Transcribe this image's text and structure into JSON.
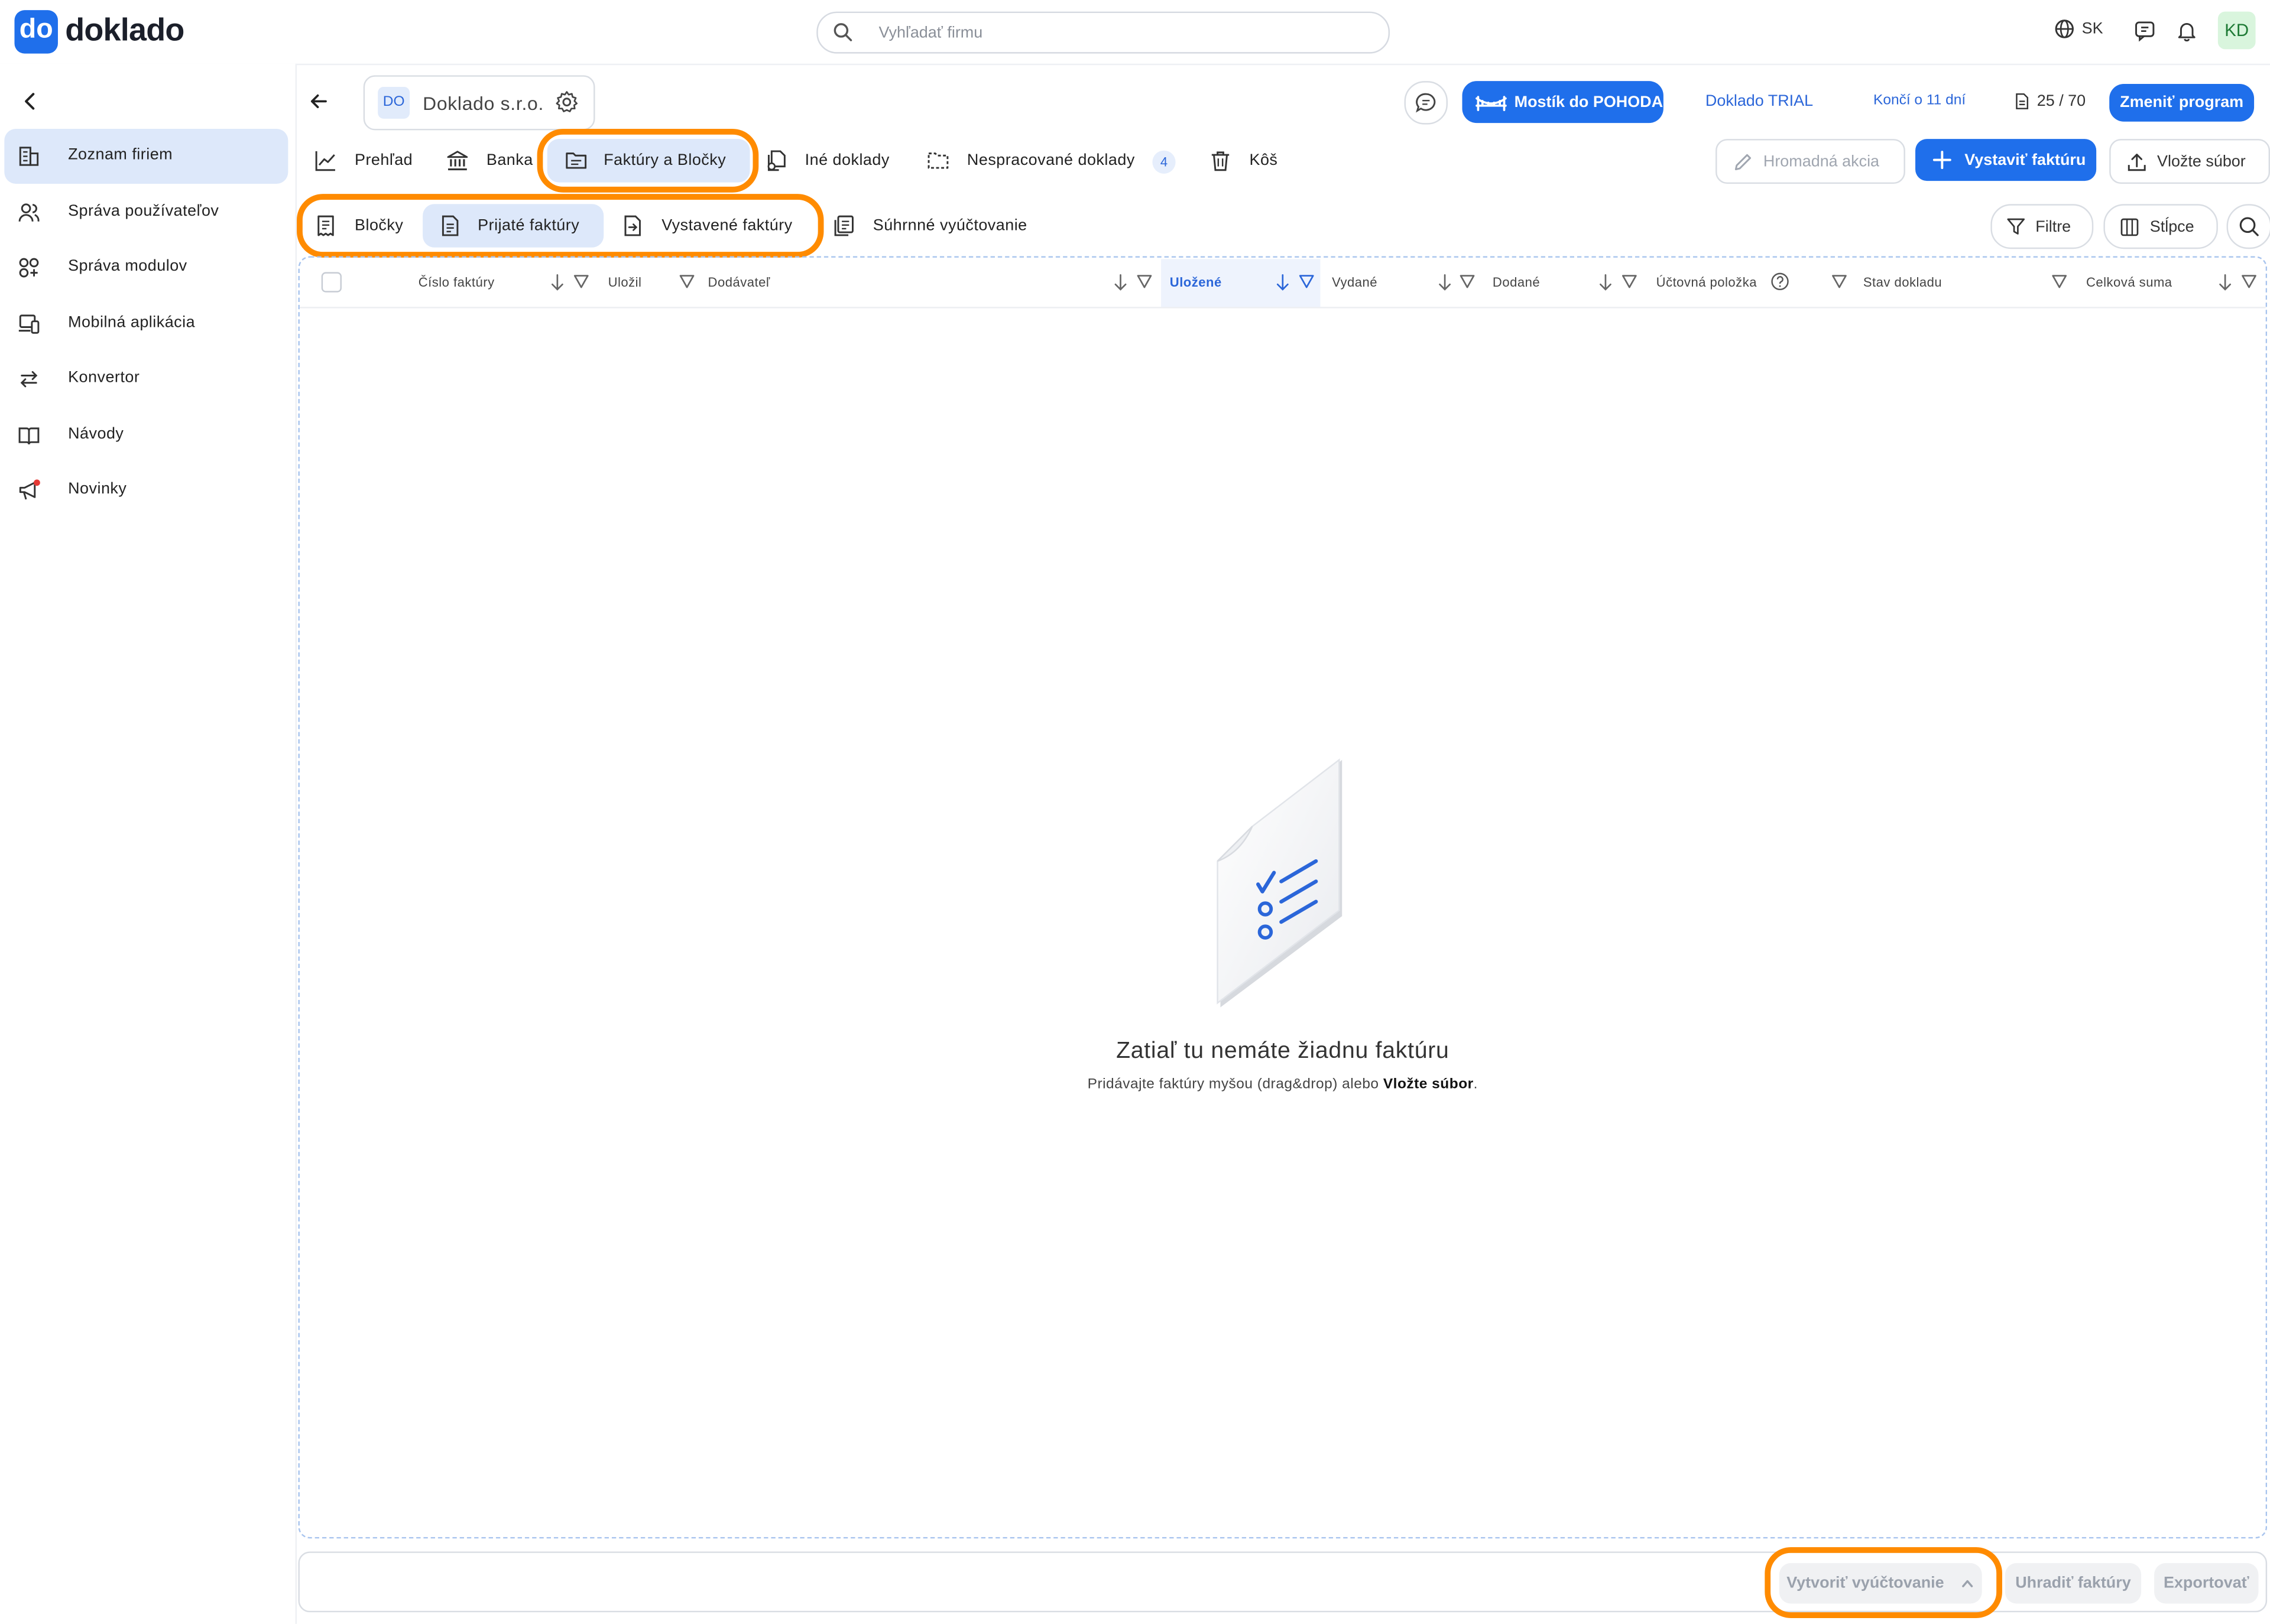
{
  "app": {
    "logo_mark": "do",
    "logo_text": "doklado",
    "accent": "#1f6feb",
    "highlight": "#ff8b00"
  },
  "header": {
    "search_placeholder": "Vyhľadať firmu",
    "language": "SK",
    "avatar_initials": "KD",
    "icons": [
      "globe-icon",
      "chat-icon",
      "bell-icon"
    ]
  },
  "sidebar": {
    "items": [
      {
        "label": "Zoznam firiem",
        "icon": "building-icon",
        "active": true
      },
      {
        "label": "Správa používateľov",
        "icon": "users-icon"
      },
      {
        "label": "Správa modulov",
        "icon": "modules-icon"
      },
      {
        "label": "Mobilná aplikácia",
        "icon": "devices-icon"
      },
      {
        "label": "Konvertor",
        "icon": "convert-icon"
      },
      {
        "label": "Návody",
        "icon": "book-icon"
      },
      {
        "label": "Novinky",
        "icon": "megaphone-icon"
      }
    ]
  },
  "company": {
    "initials": "DO",
    "name": "Doklado s.r.o."
  },
  "topbar": {
    "pohoda_label": "Mostík do POHODA",
    "trial_label": "Doklado TRIAL",
    "ends_label": "Končí o 11 dní",
    "counter": "25 / 70",
    "change_plan_label": "Zmeniť program"
  },
  "tabs": [
    {
      "label": "Prehľad",
      "icon": "chart-icon"
    },
    {
      "label": "Banka",
      "icon": "bank-icon"
    },
    {
      "label": "Faktúry a Bločky",
      "icon": "folder-icon",
      "active": true
    },
    {
      "label": "Iné doklady",
      "icon": "documents-icon"
    },
    {
      "label": "Nespracované doklady",
      "icon": "dashed-folder-icon",
      "badge": "4"
    },
    {
      "label": "Kôš",
      "icon": "trash-icon"
    }
  ],
  "actions": {
    "bulk_label": "Hromadná akcia",
    "issue_invoice_label": "Vystaviť faktúru",
    "upload_label": "Vložte súbor"
  },
  "subtabs": [
    {
      "label": "Bločky",
      "icon": "receipt-icon"
    },
    {
      "label": "Prijaté faktúry",
      "icon": "invoice-icon",
      "active": true
    },
    {
      "label": "Vystavené faktúry",
      "icon": "invoice-out-icon"
    },
    {
      "label": "Súhrnné vyúčtovanie",
      "icon": "summary-icon"
    }
  ],
  "toolbar": {
    "filters_label": "Filtre",
    "columns_label": "Stĺpce"
  },
  "table": {
    "columns": [
      {
        "label": "Číslo faktúry"
      },
      {
        "label": "Uložil"
      },
      {
        "label": "Dodávateľ"
      },
      {
        "label": "Uložené",
        "active": true
      },
      {
        "label": "Vydané"
      },
      {
        "label": "Dodané"
      },
      {
        "label": "Účtovná položka"
      },
      {
        "label": "Stav dokladu"
      },
      {
        "label": "Celková suma"
      }
    ],
    "empty_title": "Zatiaľ tu nemáte žiadnu faktúru",
    "empty_text": "Pridávajte faktúry myšou (drag&drop) alebo ",
    "empty_link": "Vložte súbor",
    "empty_end": "."
  },
  "footer": {
    "create_billing_label": "Vytvoriť vyúčtovanie",
    "pay_label": "Uhradiť faktúry",
    "export_label": "Exportovať"
  }
}
